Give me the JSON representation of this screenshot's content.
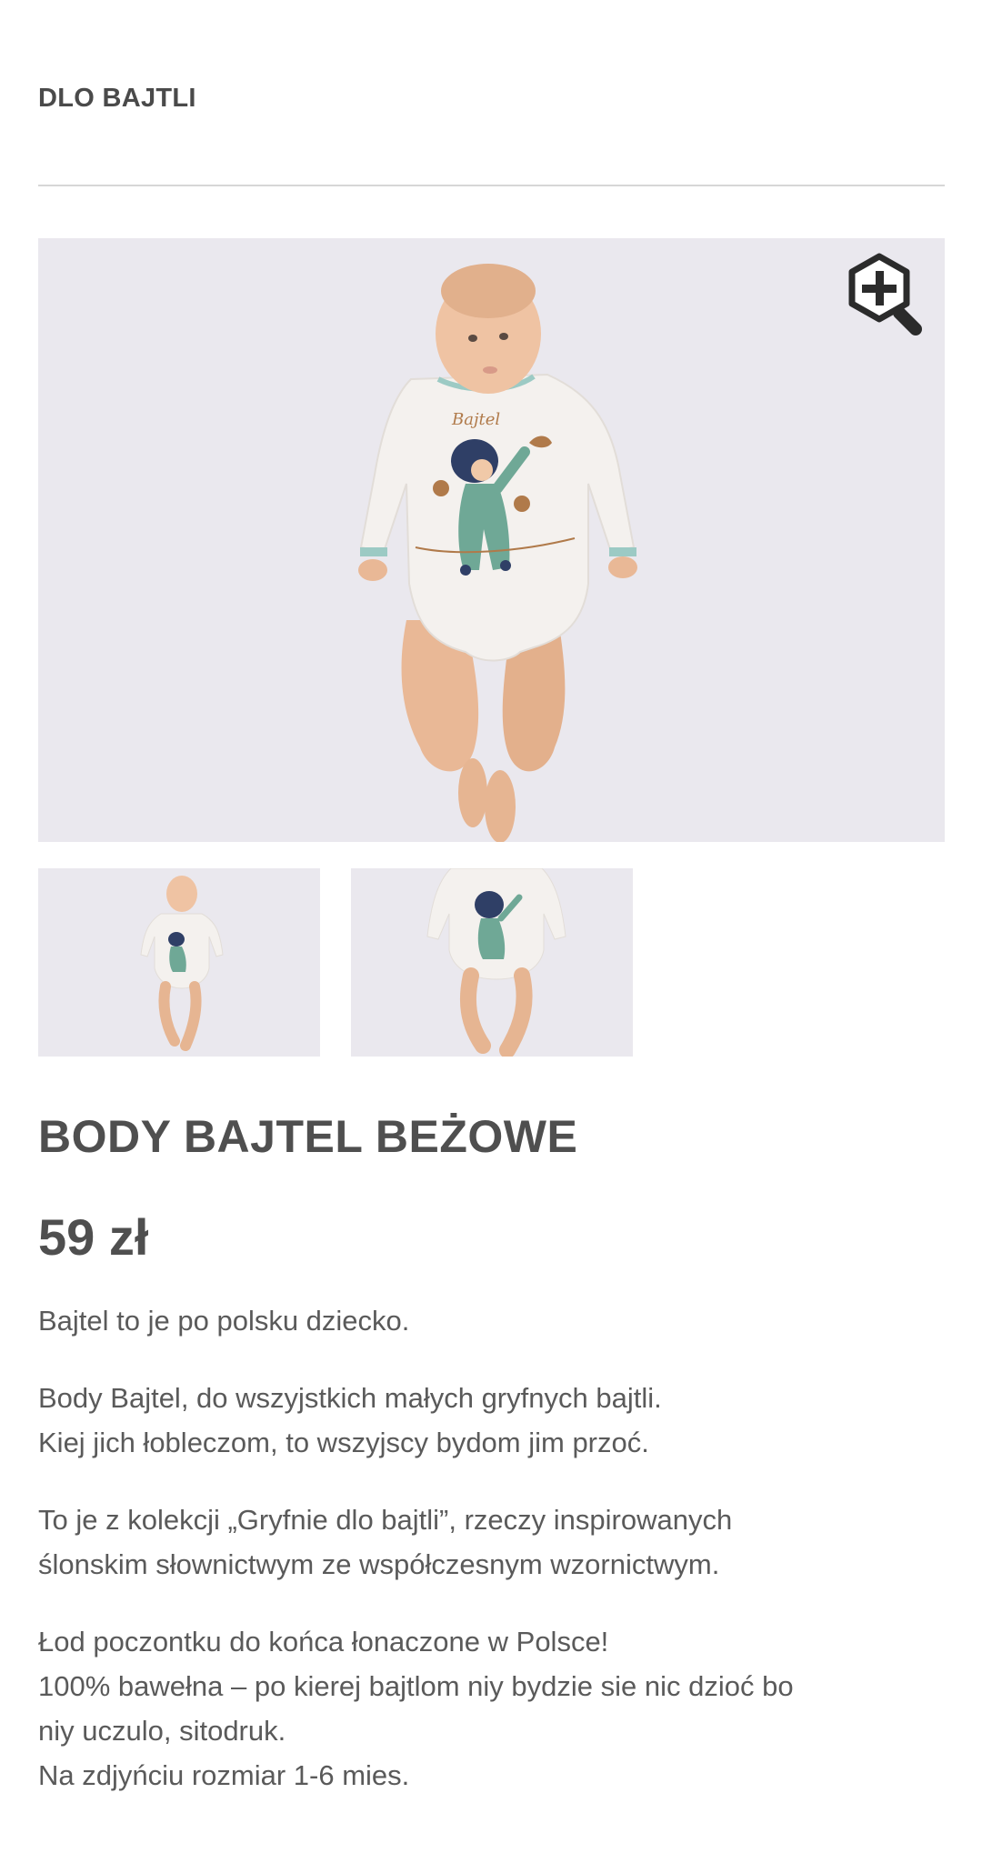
{
  "header": {
    "category": "DLO BAJTLI"
  },
  "gallery": {
    "main_image_label": "Baby wearing Bajtel bodysuit",
    "zoom_icon": "zoom-in-icon",
    "thumbnails": [
      {
        "label": "Bajtel bodysuit full view"
      },
      {
        "label": "Bajtel bodysuit close view"
      }
    ],
    "print_text": "Bajtel"
  },
  "product": {
    "title": "BODY BAJTEL BEŻOWE",
    "price": "59 zł",
    "description": {
      "p1_l1": "Bajtel to je po polsku dziecko.",
      "p2_l1": "Body Bajtel, do wszyjstkich małych gryfnych bajtli.",
      "p2_l2": "Kiej jich łobleczom, to wszyjscy bydom jim przoć.",
      "p3_l1": "To je z kolekcji „Gryfnie dlo bajtli”, rzeczy inspirowanych",
      "p3_l2": "ślonskim słownictwym ze współczesnym wzornictwym.",
      "p4_l1": "Łod poczontku do końca łonaczone w Polsce!",
      "p4_l2": "100% bawełna – po kierej bajtlom niy bydzie sie nic dzioć bo",
      "p4_l3": "niy uczulo, sitodruk.",
      "p4_l4": "Na zdjyńciu rozmiar 1-6 mies."
    }
  },
  "colors": {
    "image_bg": "#eae8ee",
    "text": "#505050",
    "divider": "#d6d6d6",
    "garment": "#f4f1ee",
    "trim": "#9ccac4",
    "character_suit": "#6fa896"
  }
}
